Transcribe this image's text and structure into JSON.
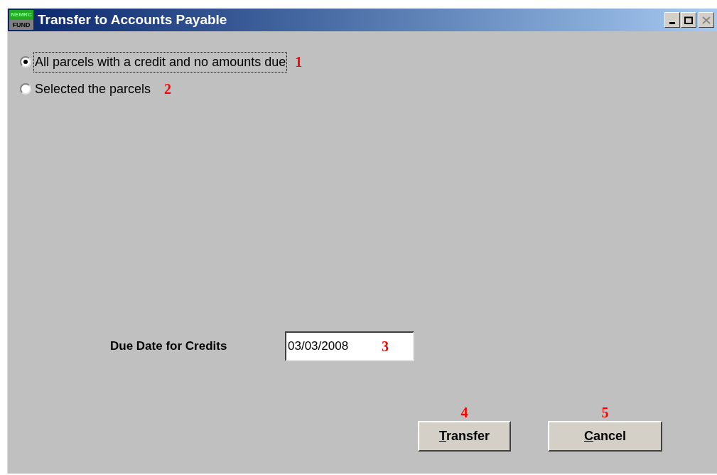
{
  "window": {
    "title": "Transfer to Accounts Payable",
    "logo_top": "NEMRC",
    "logo_bottom": "FUND"
  },
  "options": [
    {
      "label": "All parcels with a credit and no amounts due",
      "selected": true,
      "callout": "1"
    },
    {
      "label": "Selected the parcels",
      "selected": false,
      "callout": "2"
    }
  ],
  "due_date": {
    "label": "Due Date for Credits",
    "value": "03/03/2008",
    "callout": "3"
  },
  "buttons": [
    {
      "label": "Transfer",
      "callout": "4"
    },
    {
      "label": "Cancel",
      "callout": "5"
    }
  ]
}
